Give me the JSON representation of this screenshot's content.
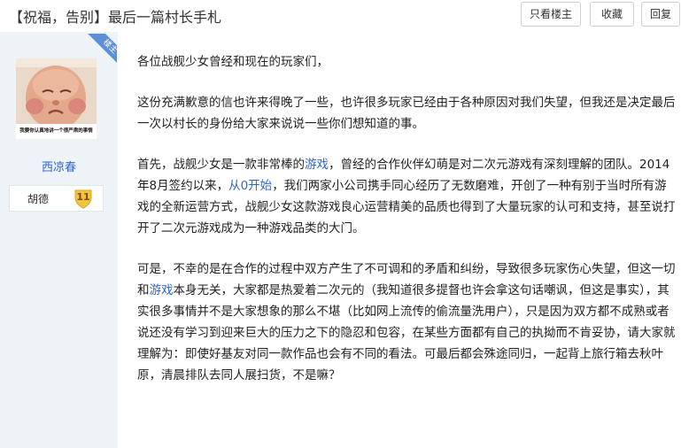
{
  "header": {
    "title": "【祝福，告别】最后一篇村长手札",
    "buttons": {
      "only_author": "只看楼主",
      "favorite": "收藏",
      "reply": "回复"
    }
  },
  "author": {
    "tag": "楼主",
    "avatar_caption": "我要你认真地讲一个很严肃的事情",
    "name": "西凉春",
    "level_name": "胡德",
    "level": "11"
  },
  "post": {
    "p1": "各位战舰少女曾经和现在的玩家们，",
    "p2": "这份充满歉意的信也许来得晚了一些，也许很多玩家已经由于各种原因对我们失望，但我还是决定最后一次以村长的身份给大家来说说一些你们想知道的事。",
    "p3_a": "首先，战舰少女是一款非常棒的",
    "p3_link1": "游戏",
    "p3_b": "，曾经的合作伙伴幻萌是对二次元游戏有深刻理解的团队。2014年8月签约以来，",
    "p3_link2": "从0开始",
    "p3_c": "，我们两家小公司携手同心经历了无数磨难，开创了一种有别于当时所有游戏的全新运营方式，战舰少女这款游戏良心运营精美的品质也得到了大量玩家的认可和支持，甚至说打开了二次元游戏成为一种游戏品类的大门。",
    "p4_a": "可是，不幸的是在合作的过程中双方产生了不可调和的矛盾和纠纷，导致很多玩家伤心失望，但这一切和",
    "p4_link": "游戏",
    "p4_b": "本身无关，大家都是热爱着二次元的（我知道很多提督也许会拿这句话嘲讽，但这是事实），其实很多事情并不是大家想象的那么不堪（比如网上流传的偷流量洗用户），只是因为双方都不成熟或者说还没有学习到迎来巨大的压力之下的隐忍和包容，在某些方面都有自己的执拗而不肯妥协，请大家就理解为：即使好基友对同一款作品也会有不同的看法。可最后都会殊途同归，一起背上旅行箱去秋叶原，清晨排队去同人展扫货，不是嘛？"
  },
  "colors": {
    "link": "#3366cc",
    "sidebar_bg": "#eef3f8",
    "louzhu_tag": "#5b8fd6",
    "badge": "#f2c53d"
  }
}
